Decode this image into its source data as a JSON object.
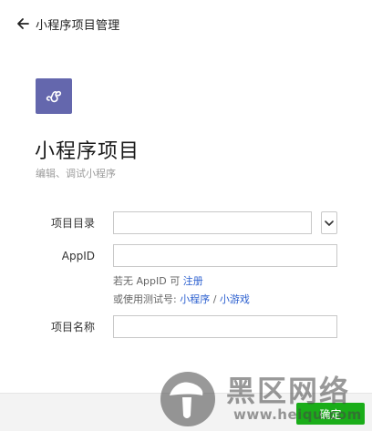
{
  "header": {
    "back_icon": "arrow-left-icon",
    "title": "小程序项目管理"
  },
  "logo": {
    "icon": "mini-program-logo-icon",
    "color": "#6467ad"
  },
  "page": {
    "title": "小程序项目",
    "subtitle": "编辑、调试小程序"
  },
  "form": {
    "directory": {
      "label": "项目目录",
      "value": "",
      "toggle_icon": "chevron-down-icon"
    },
    "appid": {
      "label": "AppID",
      "value": ""
    },
    "hint_line1": {
      "prefix": "若无 AppID 可 ",
      "link": "注册"
    },
    "hint_line2": {
      "prefix": "或使用测试号: ",
      "link1": "小程序",
      "separator": " / ",
      "link2": "小游戏"
    },
    "name": {
      "label": "项目名称",
      "value": ""
    }
  },
  "footer": {
    "confirm_label": "确定",
    "accent": "#1aad19"
  },
  "watermark": {
    "text": "黑区网络",
    "url": "www.heiqu.com"
  }
}
